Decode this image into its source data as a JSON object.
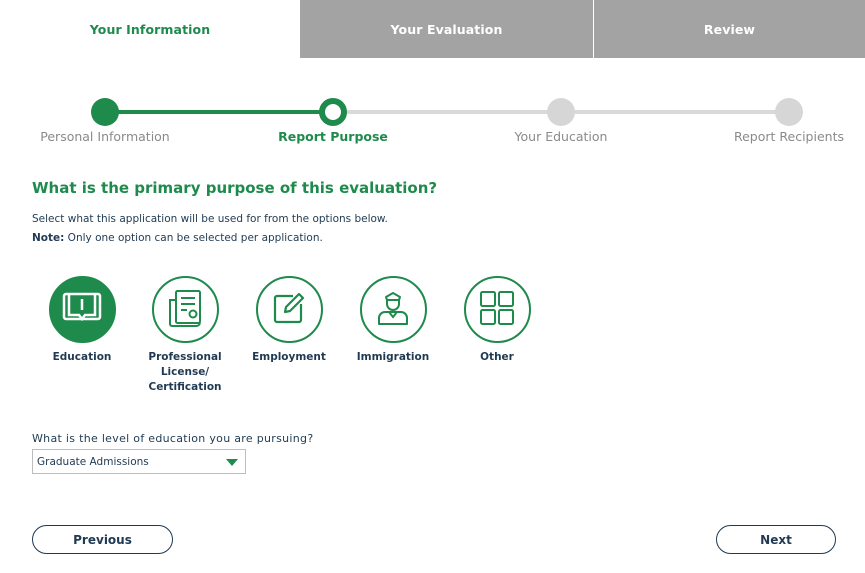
{
  "tabs": [
    {
      "label": "Your Information",
      "active": true
    },
    {
      "label": "Your Evaluation",
      "active": false
    },
    {
      "label": "Review",
      "active": false
    }
  ],
  "stepper": {
    "steps": [
      {
        "label": "Personal Information",
        "state": "done"
      },
      {
        "label": "Report Purpose",
        "state": "current"
      },
      {
        "label": "Your Education",
        "state": "todo"
      },
      {
        "label": "Report Recipients",
        "state": "todo"
      }
    ]
  },
  "question": {
    "title": "What is the primary purpose of this evaluation?",
    "instruction": "Select what this application will be used for from the options below.",
    "note_label": "Note:",
    "note_text": " Only one option can be selected per application."
  },
  "options": [
    {
      "label": "Education",
      "icon": "book-icon",
      "selected": true
    },
    {
      "label": "Professional License/ Certification",
      "icon": "certificate-icon",
      "selected": false
    },
    {
      "label": "Employment",
      "icon": "edit-icon",
      "selected": false
    },
    {
      "label": "Immigration",
      "icon": "officer-icon",
      "selected": false
    },
    {
      "label": "Other",
      "icon": "grid-icon",
      "selected": false
    }
  ],
  "education_level": {
    "question": "What is the level of education you are pursuing?",
    "selected": "Graduate Admissions"
  },
  "nav": {
    "previous_label": "Previous",
    "next_label": "Next"
  },
  "colors": {
    "accent": "#1e8b4c",
    "text": "#1f3a52",
    "inactive_tab": "#a3a3a3",
    "inactive_step": "#d6d6d6"
  }
}
